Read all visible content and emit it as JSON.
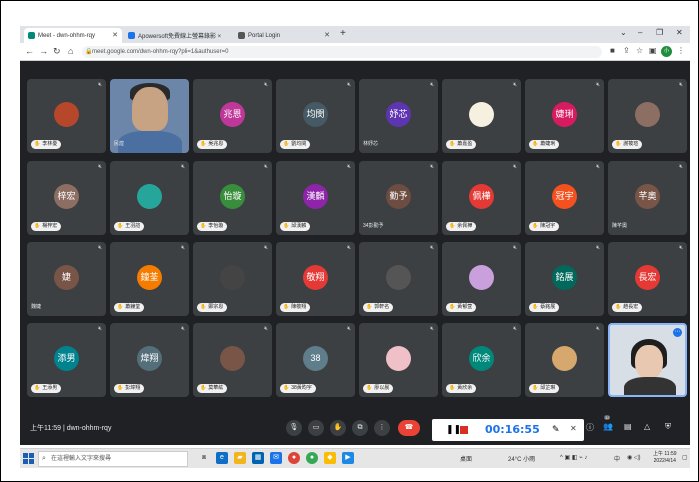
{
  "browser": {
    "tabs": [
      {
        "label": "Meet - dwn-ohhm-rqy",
        "active": true,
        "icon": "meet-icon",
        "color": "#00897b"
      },
      {
        "label": "Apowersoft免費線上螢幕錄影 ×",
        "active": false,
        "icon": "apowersoft-icon",
        "color": "#1a73e8"
      },
      {
        "label": "Portal Login",
        "active": false,
        "icon": "portal-icon",
        "color": "#555555"
      }
    ],
    "url": "meet.google.com/dwn-ohhm-rqy?pli=1&authuser=0",
    "profile_initial": "小"
  },
  "meet": {
    "tiles": [
      {
        "name": "李林憂",
        "type": "pic",
        "color": "#b7472a",
        "hand": true
      },
      {
        "name": "民煌",
        "type": "video",
        "hand": false
      },
      {
        "name": "吳兆恩",
        "avatar": "兆恩",
        "color": "#c0379a",
        "hand": true
      },
      {
        "name": "劉均閔",
        "avatar": "均閔",
        "color": "#455a64",
        "hand": true
      },
      {
        "name": "林妤芯",
        "avatar": "妤芯",
        "color": "#5e35b1",
        "hand": false
      },
      {
        "name": "蕭嘉盈",
        "type": "pic",
        "color": "#f5f0e0",
        "hand": true
      },
      {
        "name": "蕭婕琍",
        "avatar": "婕琍",
        "color": "#d81b60",
        "hand": true
      },
      {
        "name": "謝筱瑄",
        "type": "pic",
        "color": "#8d6e63",
        "hand": true
      },
      {
        "name": "楊梓宏",
        "avatar": "梓宏",
        "color": "#8d6e63",
        "hand": true
      },
      {
        "name": "王羽諠",
        "type": "pic",
        "color": "#26a69a",
        "hand": true
      },
      {
        "name": "李怡璇",
        "avatar": "怡璇",
        "color": "#388e3c",
        "hand": true
      },
      {
        "name": "邱漢麟",
        "avatar": "漢麟",
        "color": "#8e24aa",
        "hand": true
      },
      {
        "name": "34彭勤予",
        "avatar": "勤予",
        "color": "#6d4c41",
        "hand": false
      },
      {
        "name": "余佩樺",
        "avatar": "佩樺",
        "color": "#e53935",
        "hand": true
      },
      {
        "name": "陳冠宇",
        "avatar": "冠宇",
        "color": "#f4511e",
        "hand": true
      },
      {
        "name": "陳芊奧",
        "avatar": "芊奧",
        "color": "#795548",
        "hand": false
      },
      {
        "name": "魏婕",
        "avatar": "婕",
        "color": "#795548",
        "hand": false
      },
      {
        "name": "蕭鐘荃",
        "avatar": "鐘荃",
        "color": "#f57c00",
        "hand": true
      },
      {
        "name": "鄭宗恩",
        "type": "pic",
        "color": "#444444",
        "hand": true
      },
      {
        "name": "陳敬翔",
        "avatar": "敬翔",
        "color": "#e53935",
        "hand": true
      },
      {
        "name": "郭軒名",
        "type": "pic",
        "color": "#555555",
        "hand": true
      },
      {
        "name": "黃郁萱",
        "type": "pic",
        "color": "#c9a0dc",
        "hand": true
      },
      {
        "name": "蔡銘展",
        "avatar": "銘展",
        "color": "#00695c",
        "hand": true
      },
      {
        "name": "趙長宏",
        "avatar": "長宏",
        "color": "#e53935",
        "hand": true
      },
      {
        "name": "王添男",
        "avatar": "添男",
        "color": "#00838f",
        "hand": true
      },
      {
        "name": "彭煒翔",
        "avatar": "煒翔",
        "color": "#546e7a",
        "hand": true
      },
      {
        "name": "莫華紘",
        "type": "pic",
        "color": "#795548",
        "hand": true
      },
      {
        "name": "38黃昀宇",
        "avatar": "38",
        "color": "#607d8b",
        "hand": true
      },
      {
        "name": "廖以晨",
        "type": "pic",
        "color": "#f0c0c8",
        "hand": true
      },
      {
        "name": "黃欣余",
        "avatar": "欣余",
        "color": "#00897b",
        "hand": true
      },
      {
        "name": "邱芷琳",
        "type": "pic",
        "color": "#d7a86e",
        "hand": true
      },
      {
        "name": "",
        "type": "video2",
        "hand": false
      }
    ],
    "meeting_info": "上午11:59 | dwn-ohhm-rqy",
    "right_badge": "32"
  },
  "recorder": {
    "time": "00:16:55"
  },
  "taskbar": {
    "search_placeholder": "在這裡輸入文字來搜尋",
    "desktop_label": "桌面",
    "weather": "24°C 小雨",
    "ime": "中",
    "clock_time": "上午 11:59",
    "clock_date": "2022/4/14"
  }
}
